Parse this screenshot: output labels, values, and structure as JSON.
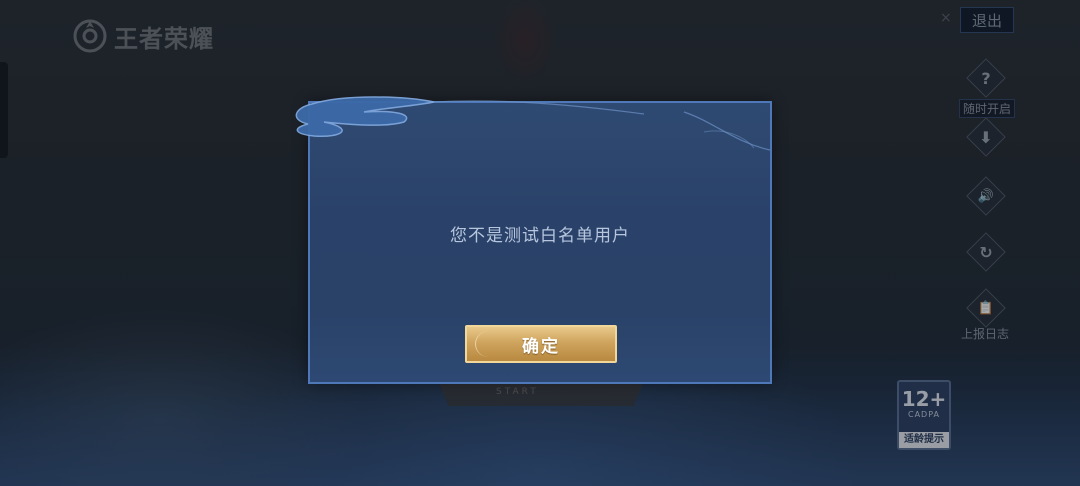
{
  "logo": {
    "text": "王者荣耀",
    "icon": "logo-emblem-icon"
  },
  "header": {
    "exit_label": "退出",
    "close_glyph": "×"
  },
  "side_buttons": [
    {
      "name": "help",
      "icon": "question-icon",
      "glyph": "?",
      "label": "随时开启"
    },
    {
      "name": "download",
      "icon": "download-icon",
      "glyph": "⬇",
      "label": ""
    },
    {
      "name": "sound",
      "icon": "speaker-icon",
      "glyph": "🔊",
      "label": ""
    },
    {
      "name": "refresh",
      "icon": "refresh-icon",
      "glyph": "↻",
      "label": ""
    },
    {
      "name": "notice",
      "icon": "clipboard-icon",
      "glyph": "📋",
      "label": "上报日志"
    }
  ],
  "age_rating": {
    "age": "12+",
    "org": "CADPA",
    "tip": "适龄提示"
  },
  "background": {
    "start_text": "START"
  },
  "dialog": {
    "message": "您不是测试白名单用户",
    "confirm_label": "确定"
  },
  "colors": {
    "dialog_bg": "#2a4269",
    "dialog_border": "#4f78b8",
    "confirm_gold": "#cfa45e",
    "message_text": "#b7c6de"
  }
}
